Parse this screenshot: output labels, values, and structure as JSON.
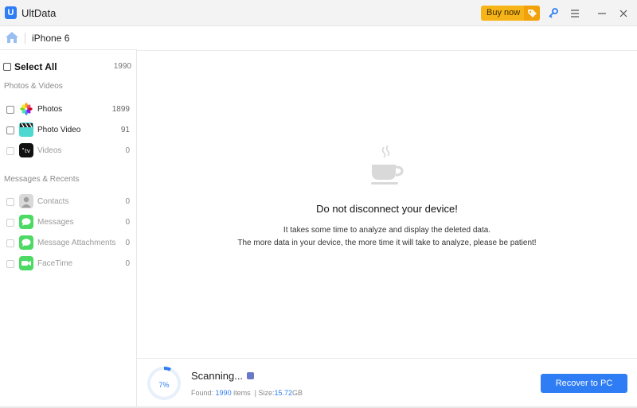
{
  "app": {
    "title": "UltData",
    "logo_letter": "U"
  },
  "titlebar": {
    "buy_label": "Buy now",
    "accent": "#f7b418",
    "icons": [
      "key-icon",
      "menu-icon",
      "minimize-icon",
      "close-icon"
    ]
  },
  "device": {
    "name": "iPhone 6"
  },
  "sidebar": {
    "select_all": {
      "label": "Select All",
      "count": "1990"
    },
    "sections": [
      {
        "title": "Photos & Videos",
        "items": [
          {
            "label": "Photos",
            "count": "1899",
            "icon": "photos-icon"
          },
          {
            "label": "Photo Video",
            "count": "91",
            "icon": "photo-video-icon"
          },
          {
            "label": "Videos",
            "count": "0",
            "icon": "apple-tv-icon"
          }
        ]
      },
      {
        "title": "Messages & Recents",
        "items": [
          {
            "label": "Contacts",
            "count": "0",
            "icon": "contacts-icon"
          },
          {
            "label": "Messages",
            "count": "0",
            "icon": "messages-icon"
          },
          {
            "label": "Message Attachments",
            "count": "0",
            "icon": "message-attachments-icon"
          },
          {
            "label": "FaceTime",
            "count": "0",
            "icon": "facetime-icon"
          }
        ]
      }
    ]
  },
  "main": {
    "title": "Do not disconnect your device!",
    "line1": "It takes some time to analyze and display the deleted data.",
    "line2": "The more data in your device, the more time it will take to analyze, please be patient!"
  },
  "footer": {
    "progress_label": "7%",
    "progress_fraction": 0.07,
    "scanning": "Scanning...",
    "found_label": "Found:",
    "found_count": "1990",
    "items_label": "items",
    "size_label": "Size:",
    "size_value": "15.72",
    "size_unit": "GB",
    "recover_label": "Recover to PC",
    "accent": "#2f7df5"
  }
}
